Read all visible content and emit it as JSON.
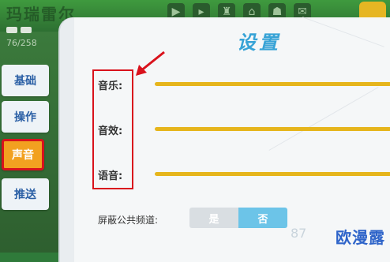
{
  "header": {
    "player_name": "玛瑞雷尔",
    "score": "76/258"
  },
  "top_icons": [
    "play-icon",
    "arrow-icon",
    "trophy-icon",
    "house-icon",
    "group-icon",
    "mail-icon"
  ],
  "sidebar": {
    "tabs": [
      {
        "label": "基础",
        "active": false
      },
      {
        "label": "操作",
        "active": false
      },
      {
        "label": "声音",
        "active": true
      },
      {
        "label": "推送",
        "active": false
      }
    ]
  },
  "panel": {
    "title": "设置",
    "rows": [
      {
        "label": "音乐:"
      },
      {
        "label": "音效:"
      },
      {
        "label": "语音:"
      }
    ],
    "mute_public": {
      "label": "屏蔽公共频道:",
      "options": [
        "是",
        "否"
      ],
      "selected": "否"
    }
  },
  "watermark": {
    "text": "欧漫露",
    "num": "87"
  },
  "colors": {
    "accent": "#37a3d6",
    "active_tab": "#f2a120",
    "highlight": "#d9121c",
    "slider": "#e6b51c"
  }
}
